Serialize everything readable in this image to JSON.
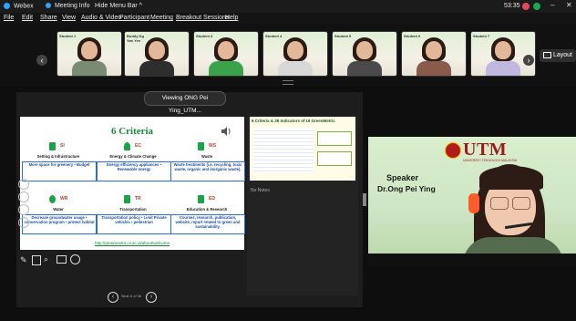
{
  "topbar": {
    "app": "Webex",
    "meeting_info": "Meeting Info",
    "hide_menu": "Hide Menu Bar",
    "chevron": "^",
    "timer": "53:35"
  },
  "menu": [
    "File",
    "Edit",
    "Share",
    "View",
    "Audio & Video",
    "Participant",
    "Meeting",
    "Breakout Sessions",
    "Help"
  ],
  "layout_button": "Layout",
  "viewing_label": "Viewing ONG Pei Ying_UTM...",
  "slide": {
    "title": "6 Criteria",
    "criteria": [
      {
        "code": "SI",
        "title": "Setting & Infrastructure",
        "text": "More space for greenery • Budget"
      },
      {
        "code": "EC",
        "title": "Energy & Climate Change",
        "text": "Energy efficiency appliances • Renewable energy"
      },
      {
        "code": "WS",
        "title": "Waste",
        "text": "Waste treatments (i.e. recycling, toxic waste, organic and inorganic waste)."
      },
      {
        "code": "WR",
        "title": "Water",
        "text": "Decrease groundwater usage • conservation program • protect habitat"
      },
      {
        "code": "TR",
        "title": "Transportation",
        "text": "Transportation policy • Limit Private vehicles • pedestrian"
      },
      {
        "code": "ED",
        "title": "Education & Research",
        "text": "Courses, research, publication, website, report related to green and sustainability."
      }
    ],
    "link": "http://greenmetric.ui.ac.id/about/welcome",
    "page_label": "Slide 6 of 36"
  },
  "notes": {
    "preview_title": "6 Criteria & 39 Indicators of UI GreenMetric",
    "notes_label": "No Notes"
  },
  "speaker": {
    "logo_text": "UTM",
    "logo_sub": "UNIVERSITI TEKNOLOGI MALAYSIA",
    "title": "Speaker",
    "name": "Dr.Ong Pei Ying"
  },
  "thumbnails": [
    {
      "name": "Student 1"
    },
    {
      "name": "Buddy Ng Yan Yee"
    },
    {
      "name": "Student 3"
    },
    {
      "name": "Student 4"
    },
    {
      "name": "Student 5"
    },
    {
      "name": "Student 6"
    },
    {
      "name": "Student 7"
    }
  ]
}
